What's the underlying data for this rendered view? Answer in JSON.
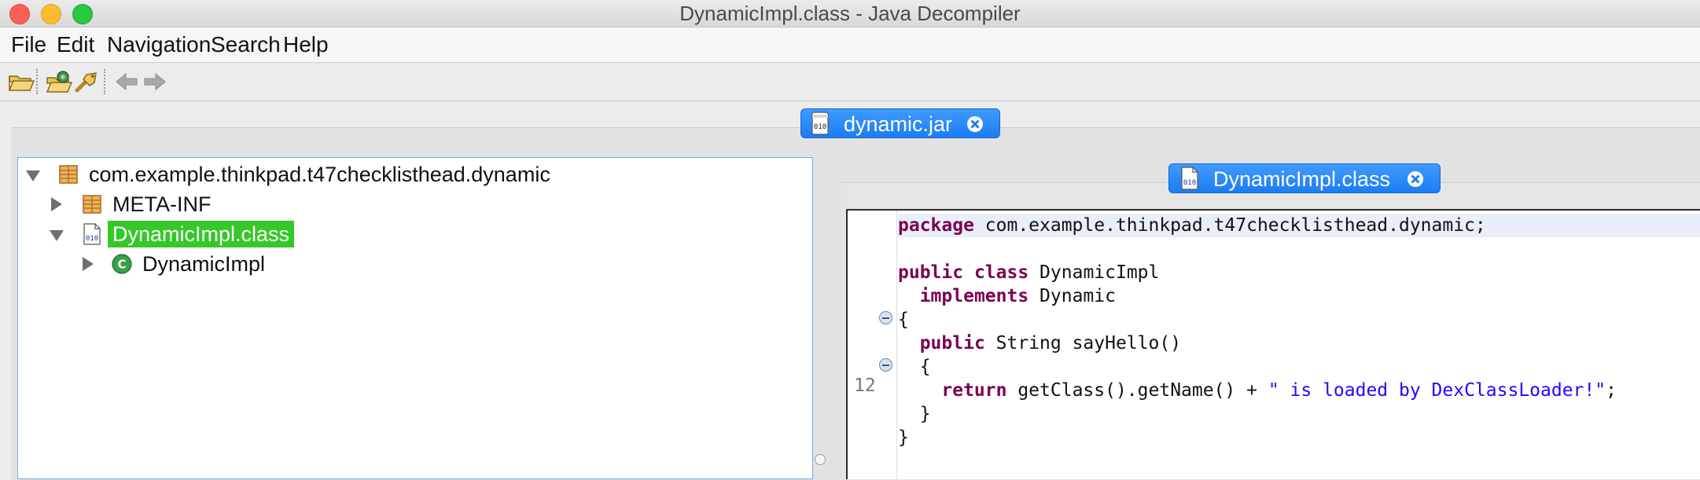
{
  "window": {
    "title": "DynamicImpl.class - Java Decompiler"
  },
  "menu": {
    "items": [
      "File",
      "Edit",
      "Navigation",
      "Search",
      "Help"
    ]
  },
  "toolbar": {
    "icons": [
      "open-file-icon",
      "open-type-icon",
      "search-type-icon",
      "back-arrow-icon",
      "forward-arrow-icon"
    ]
  },
  "tabs": {
    "jar": {
      "label": "dynamic.jar"
    },
    "class": {
      "label": "DynamicImpl.class"
    }
  },
  "tree": {
    "nodes": [
      {
        "label": "com.example.thinkpad.t47checklisthead.dynamic",
        "expanded": true,
        "icon": "package-icon"
      },
      {
        "label": "META-INF",
        "expanded": false,
        "icon": "package-icon"
      },
      {
        "label": "DynamicImpl.class",
        "expanded": true,
        "icon": "class-file-icon",
        "selected": true
      },
      {
        "label": "DynamicImpl",
        "expanded": false,
        "icon": "class-icon"
      }
    ]
  },
  "code": {
    "line_number": "12",
    "lines": [
      {
        "kw": "package",
        "text": " com.example.thinkpad.t47checklisthead.dynamic;"
      },
      {
        "kw1": "public",
        "kw2": "class",
        "text": " DynamicImpl"
      },
      {
        "kw": "implements",
        "text": " Dynamic"
      },
      {
        "text": "{"
      },
      {
        "kw": "public",
        "text": " String sayHello()"
      },
      {
        "text": "{"
      },
      {
        "kw": "return",
        "text": " getClass().getName() + ",
        "str": "\" is loaded by DexClassLoader!\"",
        "tail": ";"
      },
      {
        "text": "}"
      },
      {
        "text": "}"
      }
    ]
  },
  "colors": {
    "tab_blue": "#1c7cf5",
    "selection_green": "#35c829",
    "keyword": "#7b0052",
    "string": "#2a00ff"
  }
}
